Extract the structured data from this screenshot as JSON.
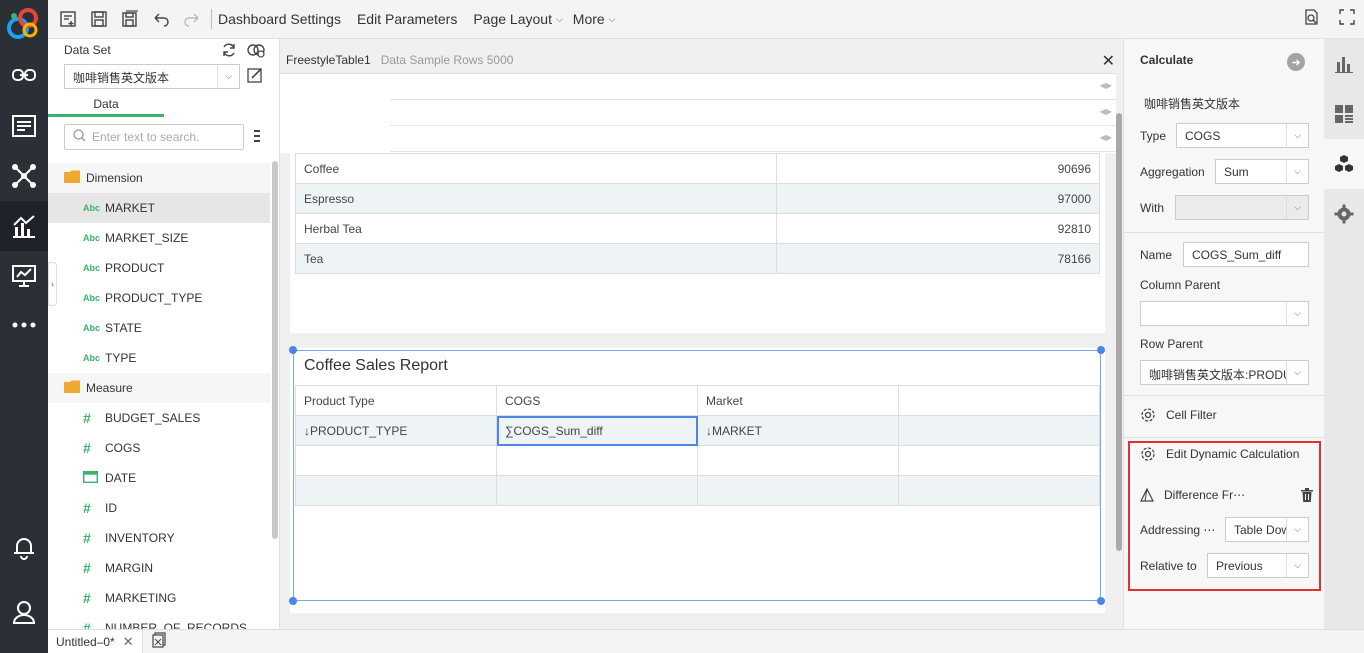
{
  "toolbar": {
    "menus": [
      "Dashboard Settings",
      "Edit Parameters",
      "Page Layout",
      "More"
    ]
  },
  "data_panel": {
    "title": "Data Set",
    "dataset": "咖啡销售英文版本",
    "tab": "Data",
    "search_placeholder": "Enter text to search.",
    "dimension_label": "Dimension",
    "dimensions": [
      "MARKET",
      "MARKET_SIZE",
      "PRODUCT",
      "PRODUCT_TYPE",
      "STATE",
      "TYPE"
    ],
    "measure_label": "Measure",
    "measures": [
      "BUDGET_SALES",
      "COGS",
      "DATE",
      "ID",
      "INVENTORY",
      "MARGIN",
      "MARKETING",
      "NUMBER_OF_RECORDS"
    ],
    "type_abc": "Abc"
  },
  "canvas": {
    "component_name": "FreestyleTable1",
    "component_info": "Data Sample Rows 5000",
    "table1": {
      "rows": [
        {
          "label": "Coffee",
          "value": "90696"
        },
        {
          "label": "Espresso",
          "value": "97000"
        },
        {
          "label": "Herbal Tea",
          "value": "92810"
        },
        {
          "label": "Tea",
          "value": "78166"
        }
      ]
    },
    "report": {
      "title": "Coffee Sales Report",
      "headers": [
        "Product Type",
        "COGS",
        "Market",
        ""
      ],
      "row": [
        "↓PRODUCT_TYPE",
        "∑COGS_Sum_diff",
        "↓MARKET",
        ""
      ]
    }
  },
  "props": {
    "title": "Calculate",
    "dataset": "咖啡销售英文版本",
    "type_label": "Type",
    "type_value": "COGS",
    "aggregation_label": "Aggregation",
    "aggregation_value": "Sum",
    "with_label": "With",
    "with_value": "",
    "name_label": "Name",
    "name_value": "COGS_Sum_diff",
    "column_parent_label": "Column Parent",
    "column_parent_value": "",
    "row_parent_label": "Row Parent",
    "row_parent_value": "咖啡销售英文版本:PRODU",
    "cell_filter": "Cell Filter",
    "edit_dynamic": "Edit Dynamic Calculation",
    "difference": "Difference Fr⋯",
    "addressing_label": "Addressing ⋯",
    "addressing_value": "Table Dow",
    "relative_label": "Relative to",
    "relative_value": "Previous"
  },
  "statusbar": {
    "doc_tab": "Untitled–0*"
  },
  "colors": {
    "rail": "#2b2f36",
    "accent_green": "#3ab36b",
    "selection_blue": "#4a86e8",
    "highlight_red": "#e03030",
    "folder": "#f0a830"
  }
}
